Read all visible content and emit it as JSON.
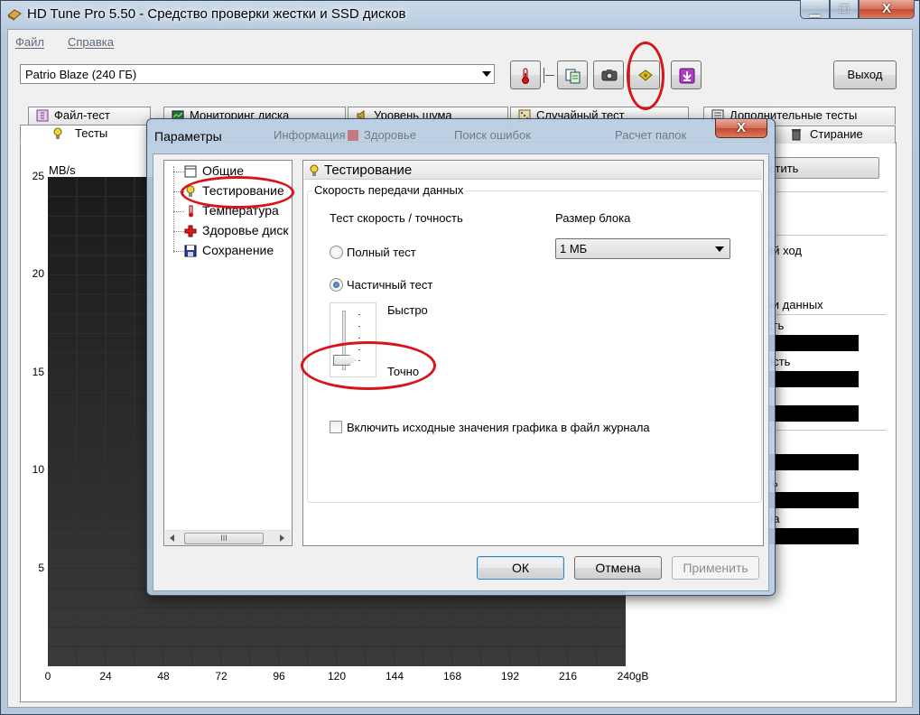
{
  "window": {
    "title": "HD Tune Pro 5.50 - Средство проверки жестки и SSD дисков",
    "min_glyph": "▁",
    "max_glyph": "□",
    "close_glyph": "X"
  },
  "menu": {
    "file": "Файл",
    "help": "Справка"
  },
  "toolbar": {
    "drive": "Patrio Blaze (240 ГБ)",
    "icons": [
      "thermometer-icon",
      "copy-icon",
      "camera-icon",
      "options-icon",
      "save-icon"
    ],
    "exit_label": "Выход"
  },
  "tabs": {
    "row1": [
      "Файл-тест",
      "Мониторинг диска",
      "Уровень шума",
      "Случайный тест",
      "Дополнительные тесты"
    ],
    "row2_visible": [
      "Тесты",
      "Стирание"
    ],
    "row2_obscured": [
      "Информация",
      "Здоровье",
      "Поиск ошибок",
      "Расчет папок"
    ]
  },
  "chart_data": {
    "type": "line",
    "title": "",
    "ylabel": "MB/s",
    "xlabel": "",
    "ylim": [
      0,
      25
    ],
    "xlim": [
      0,
      240
    ],
    "y_ticks": [
      "25",
      "20",
      "15",
      "10",
      "5"
    ],
    "x_ticks": [
      "0",
      "24",
      "48",
      "72",
      "96",
      "120",
      "144",
      "168",
      "192",
      "216",
      "240gB"
    ],
    "series": []
  },
  "right_panel": {
    "start_label": "стить",
    "move_label": "ий ход",
    "transfer_label": "чи данных",
    "min_label": "сть",
    "max_label": "ость",
    "label_a": "ть",
    "label_b": "ра"
  },
  "dialog": {
    "title": "Параметры",
    "close_glyph": "X",
    "tree": [
      "Общие",
      "Тестирование",
      "Температура",
      "Здоровье диск",
      "Сохранение"
    ],
    "scroll_thumb": "III",
    "pane_title": "Тестирование",
    "group_label": "Скорость передачи данных",
    "speed_label": "Тест скорость / точность",
    "blocksize_label": "Размер блока",
    "blocksize_value": "1 МБ",
    "radio_full": "Полный тест",
    "radio_partial": "Частичный тест",
    "slider_fast": "Быстро",
    "slider_accurate": "Точно",
    "checkbox_label": "Включить исходные значения графика в файл журнала",
    "ok": "ОК",
    "cancel": "Отмена",
    "apply": "Применить"
  }
}
